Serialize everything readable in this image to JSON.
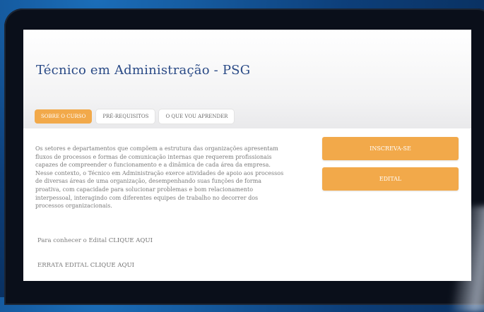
{
  "page": {
    "title": "Técnico em Administração - PSG"
  },
  "tabs": [
    {
      "label": "SOBRE O CURSO",
      "active": true
    },
    {
      "label": "PRÉ-REQUISITOS",
      "active": false
    },
    {
      "label": "O QUE VOU APRENDER",
      "active": false
    }
  ],
  "description": "Os setores e departamentos que compõem a estrutura das organizações apresentam fluxos de processos e formas de comunicação internas que requerem profissionais capazes de compreender o funcionamento e a dinâmica de cada área da empresa. Nesse contexto, o Técnico em Administração exerce atividades de apoio aos processos de diversas áreas de uma organização, desempenhando suas funções de forma proativa, com capacidade para solucionar problemas e bom relacionamento interpessoal, interagindo com diferentes equipes de trabalho no decorrer dos processos organizacionais.",
  "links": {
    "edital": {
      "text": "Para conhecer o Edital",
      "link": "CLIQUE AQUI"
    },
    "errata": {
      "text": "ERRATA EDITAL",
      "link": "CLIQUE AQUI"
    }
  },
  "buttons": {
    "inscreva": "INSCREVA-SE",
    "edital": "EDITAL"
  },
  "colors": {
    "accent": "#f2a94a",
    "title": "#2a4a86",
    "background": "#0d3f7a"
  }
}
